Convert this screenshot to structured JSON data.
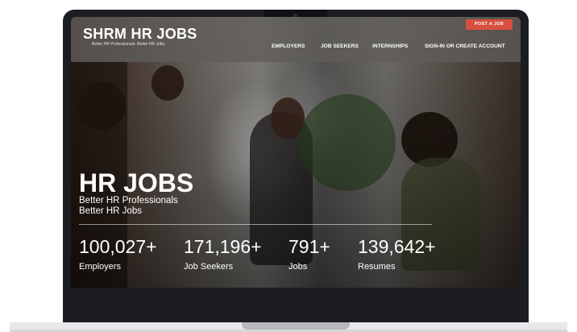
{
  "site": {
    "logo": "SHRM HR JOBS",
    "tagline": "Better HR Professionals. Better HR Jobs."
  },
  "nav": {
    "post_job": "POST A JOB",
    "items": [
      {
        "label": "EMPLOYERS"
      },
      {
        "label": "JOB SEEKERS"
      },
      {
        "label": "INTERNSHIPS"
      },
      {
        "label": "SIGN-IN OR CREATE ACCOUNT"
      }
    ]
  },
  "hero": {
    "logo": "HR JOBS",
    "tagline_1": "Better HR Professionals",
    "tagline_2": "Better HR Jobs"
  },
  "stats": [
    {
      "value": "100,027+",
      "label": "Employers"
    },
    {
      "value": "171,196+",
      "label": "Job Seekers"
    },
    {
      "value": "791+",
      "label": "Jobs"
    },
    {
      "value": "139,642+",
      "label": "Resumes"
    }
  ],
  "colors": {
    "accent": "#d94f3d",
    "laptop_frame": "#1c1d21",
    "header_bg": "#5f5c5a"
  }
}
